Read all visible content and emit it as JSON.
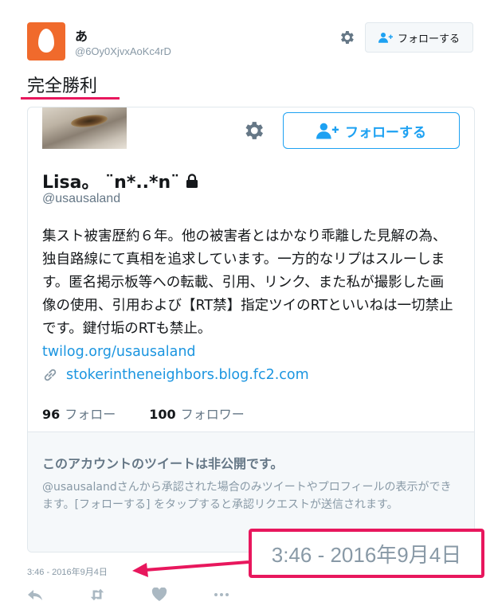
{
  "user": {
    "display_name": "あ",
    "handle": "@6Oy0XjvxAoKc4rD"
  },
  "header": {
    "follow_label": "フォローする"
  },
  "tweet": {
    "text": "完全勝利"
  },
  "card": {
    "follow_label": "フォローする",
    "name": "Lisa。 ¨n*..*n¨",
    "handle": "@usausaland",
    "bio": "集スト被害歴約６年。他の被害者とはかなり乖離した見解の為、独自路線にて真相を追求しています。一方的なリプはスルーします。匿名掲示板等への転載、引用、リンク、また私が撮影した画像の使用、引用および【RT禁】指定ツイのRTといいねは一切禁止です。鍵付垢のRTも禁止。",
    "bio_link": "twilog.org/usausaland",
    "website": "stokerintheneighbors.blog.fc2.com",
    "following_count": "96",
    "following_label": "フォロー",
    "followers_count": "100",
    "followers_label": "フォロワー",
    "protected_title": "このアカウントのツイートは非公開です。",
    "protected_body": "@usausalandさんから承認された場合のみツイートやプロフィールの表示ができます。[フォローする] をタップすると承認リクエストが送信されます。"
  },
  "timestamp": "3:46 - 2016年9月4日",
  "callout": "3:46 - 2016年9月4日",
  "colors": {
    "accent": "#1da1f2",
    "annotation": "#e8175d",
    "avatar": "#f06a2c"
  },
  "icons": [
    "settings-gear-icon",
    "follow-person-plus-icon",
    "lock-icon",
    "link-icon",
    "reply-icon",
    "retweet-icon",
    "like-heart-icon",
    "more-dots-icon"
  ]
}
